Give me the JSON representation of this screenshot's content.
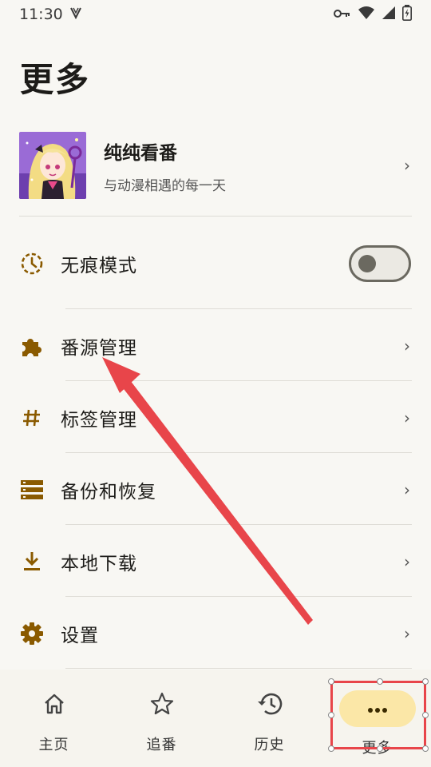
{
  "status": {
    "time": "11:30",
    "carrier_icon": "v-icon",
    "icons": [
      "key-icon",
      "wifi-icon",
      "signal-icon",
      "battery-icon"
    ]
  },
  "page": {
    "title": "更多"
  },
  "profile": {
    "name": "纯纯看番",
    "slogan": "与动漫相遇的每一天"
  },
  "menu": [
    {
      "id": "incognito",
      "label": "无痕模式",
      "icon": "incognito-clock-icon",
      "toggle": true,
      "toggle_on": false
    },
    {
      "id": "sources",
      "label": "番源管理",
      "icon": "puzzle-icon"
    },
    {
      "id": "tags",
      "label": "标签管理",
      "icon": "hash-icon"
    },
    {
      "id": "backup",
      "label": "备份和恢复",
      "icon": "storage-icon"
    },
    {
      "id": "downloads",
      "label": "本地下载",
      "icon": "download-icon"
    },
    {
      "id": "settings",
      "label": "设置",
      "icon": "gear-icon"
    }
  ],
  "chevron": "›",
  "bottom_nav": [
    {
      "id": "home",
      "label": "主页",
      "icon": "home-icon",
      "active": false
    },
    {
      "id": "follow",
      "label": "追番",
      "icon": "star-icon",
      "active": false
    },
    {
      "id": "history",
      "label": "历史",
      "icon": "history-icon",
      "active": false
    },
    {
      "id": "more",
      "label": "更多",
      "icon": "more-dots-icon",
      "active": true
    }
  ],
  "colors": {
    "accent": "#8a5a00",
    "active_pill": "#fbe7a7",
    "annotation": "#e8454a",
    "background": "#f8f7f3"
  }
}
